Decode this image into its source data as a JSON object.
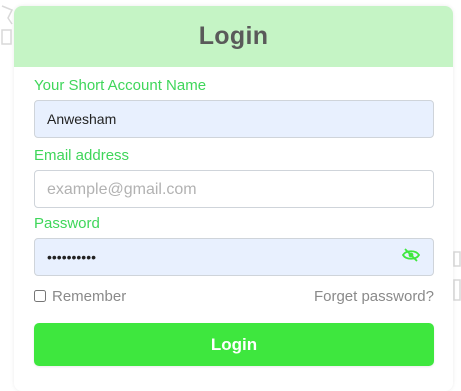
{
  "header": {
    "title": "Login"
  },
  "form": {
    "account_name": {
      "label": "Your Short Account Name",
      "value": "Anwesham"
    },
    "email": {
      "label": "Email address",
      "placeholder": "example@gmail.com",
      "value": ""
    },
    "password": {
      "label": "Password",
      "masked_value": "••••••••••",
      "toggle_icon": "eye-slash-icon"
    },
    "remember": {
      "label": "Remember",
      "checked": false
    },
    "forgot_link": "Forget password?",
    "submit_label": "Login"
  },
  "colors": {
    "header_bg": "#c5f4c5",
    "accent_green": "#3ee73e",
    "label_green": "#3fd65a",
    "autofill_bg": "#e8f0fe"
  }
}
